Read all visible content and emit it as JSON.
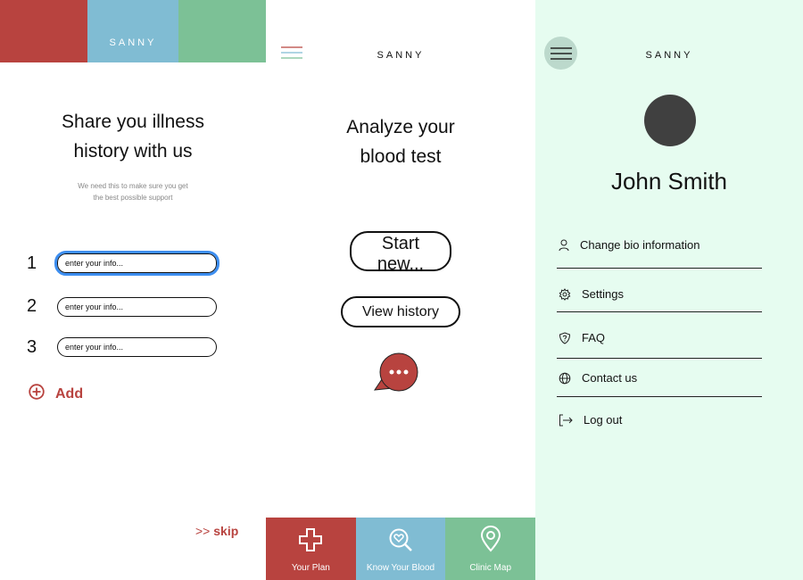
{
  "screen1": {
    "brand": "SANNY",
    "colors": {
      "red": "#b8433f",
      "blue": "#80bcd3",
      "green": "#7cc196",
      "focus": "#3d8ef0"
    },
    "title_line1": "Share you illness",
    "title_line2": "history with us",
    "subtitle_line1": "We need this to make sure you get",
    "subtitle_line2": "the best possible support",
    "fields": [
      {
        "number": "1",
        "placeholder": "enter your info..."
      },
      {
        "number": "2",
        "placeholder": "enter your info..."
      },
      {
        "number": "3",
        "placeholder": "enter your info..."
      }
    ],
    "add_label": "Add",
    "skip_arrows": ">>",
    "skip_label": "skip"
  },
  "screen2": {
    "brand": "SANNY",
    "title_line1": "Analyze your",
    "title_line2": "blood test",
    "start_button": "Start new...",
    "history_button": "View history",
    "chat_icon": "speech-bubble-icon",
    "tabs": [
      {
        "label": "Your Plan",
        "icon": "cross-icon"
      },
      {
        "label": "Know Your Blood",
        "icon": "magnifier-heart-icon"
      },
      {
        "label": "Clinic Map",
        "icon": "map-pin-icon"
      }
    ]
  },
  "screen3": {
    "brand": "SANNY",
    "user_name": "John Smith",
    "menu": [
      {
        "label": "Change bio information",
        "icon": "person-icon"
      },
      {
        "label": "Settings",
        "icon": "gear-icon"
      },
      {
        "label": "FAQ",
        "icon": "shield-question-icon"
      },
      {
        "label": "Contact us",
        "icon": "globe-icon"
      },
      {
        "label": "Log out",
        "icon": "logout-icon"
      }
    ],
    "background": "#e6fcf0"
  }
}
